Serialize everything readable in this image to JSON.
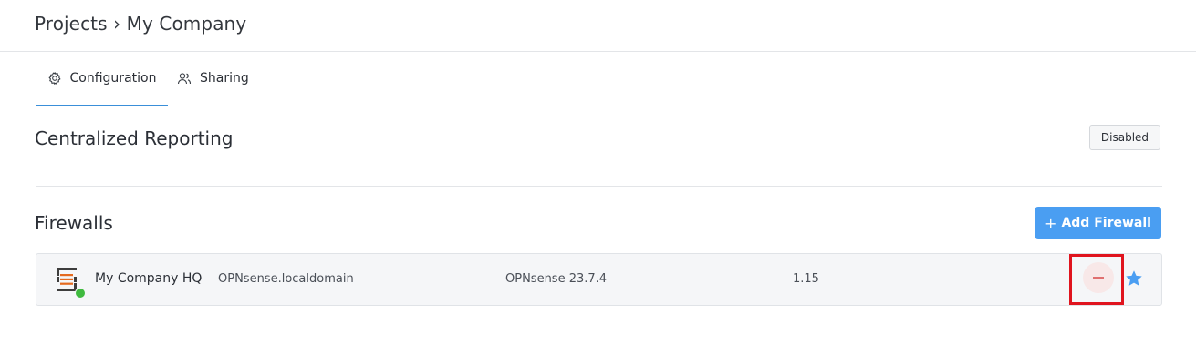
{
  "breadcrumb": {
    "text": "Projects › My Company"
  },
  "tabs": [
    {
      "label": "Configuration",
      "icon": "gear-icon",
      "active": true
    },
    {
      "label": "Sharing",
      "icon": "users-icon",
      "active": false
    }
  ],
  "reporting": {
    "title": "Centralized Reporting",
    "status": "Disabled"
  },
  "firewalls": {
    "title": "Firewalls",
    "add_label": "Add Firewall",
    "add_icon": "plus-icon",
    "rows": [
      {
        "name": "My Company HQ",
        "hostname": "OPNsense.localdomain",
        "version": "OPNsense 23.7.4",
        "number": "1.15",
        "status_color": "#3fba3f",
        "actions": [
          "remove-icon",
          "star-icon"
        ]
      }
    ]
  },
  "colors": {
    "accent": "#4a9ef2",
    "tab_underline": "#3a8fd9",
    "online": "#3fba3f",
    "remove": "#e07070",
    "highlight": "#e0141e"
  }
}
